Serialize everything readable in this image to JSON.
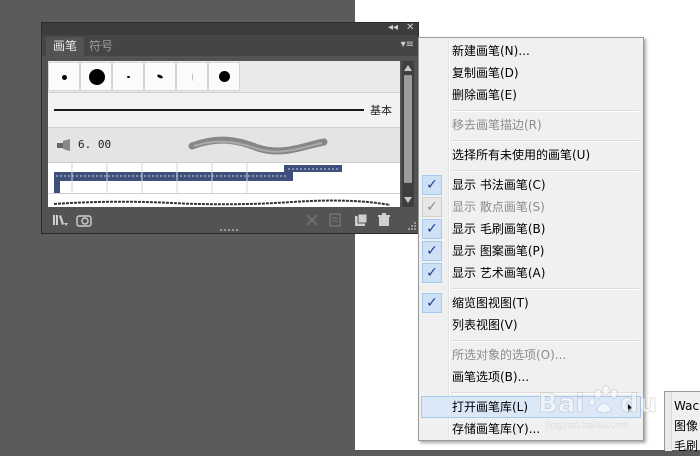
{
  "panel": {
    "tabs": [
      {
        "label": "画笔",
        "active": true
      },
      {
        "label": "符号",
        "active": false
      }
    ],
    "titlebar": {
      "collapse_glyph": "◂◂",
      "close_glyph": "✕"
    },
    "menu_button_glyph": "▾≡",
    "brushes": {
      "calligraphic_count": 6,
      "basic_label": "基本",
      "bristle_size": "6. 00"
    },
    "footer_icons": [
      "brush-libraries-menu-icon",
      "brush-library-panel-icon",
      "remove-brush-stroke-icon",
      "brush-options-icon",
      "new-brush-icon",
      "delete-brush-icon"
    ]
  },
  "context_menu": {
    "items": [
      {
        "label": "新建画笔(N)...",
        "enabled": true,
        "checked": false
      },
      {
        "label": "复制画笔(D)",
        "enabled": true,
        "checked": false
      },
      {
        "label": "删除画笔(E)",
        "enabled": true,
        "checked": false
      },
      {
        "label": "移去画笔描边(R)",
        "enabled": false,
        "checked": false
      },
      {
        "label": "选择所有未使用的画笔(U)",
        "enabled": true,
        "checked": false
      },
      {
        "label": "显示 书法画笔(C)",
        "enabled": true,
        "checked": true
      },
      {
        "label": "显示 散点画笔(S)",
        "enabled": false,
        "checked": true
      },
      {
        "label": "显示 毛刷画笔(B)",
        "enabled": true,
        "checked": true
      },
      {
        "label": "显示 图案画笔(P)",
        "enabled": true,
        "checked": true
      },
      {
        "label": "显示 艺术画笔(A)",
        "enabled": true,
        "checked": true
      },
      {
        "label": "缩览图视图(T)",
        "enabled": true,
        "checked": true
      },
      {
        "label": "列表视图(V)",
        "enabled": true,
        "checked": false
      },
      {
        "label": "所选对象的选项(O)...",
        "enabled": false,
        "checked": false
      },
      {
        "label": "画笔选项(B)...",
        "enabled": true,
        "checked": false
      },
      {
        "label": "打开画笔库(L)",
        "enabled": true,
        "checked": false,
        "highlighted": true,
        "has_submenu": true
      },
      {
        "label": "存储画笔库(Y)...",
        "enabled": true,
        "checked": false
      }
    ],
    "check_glyph": "✓"
  },
  "submenu": {
    "items": [
      "Wac",
      "图像",
      "毛刷"
    ]
  },
  "watermark": {
    "text": "Bai",
    "text2": "du",
    "subtext": "jingyan.baidu.com"
  },
  "colors": {
    "workspace_gray": "#5b5b5b",
    "panel_bg": "#535353",
    "menu_bg": "#f0f0f0",
    "highlight": "#dbe8f8",
    "check_blue": "#1a3e8c"
  }
}
